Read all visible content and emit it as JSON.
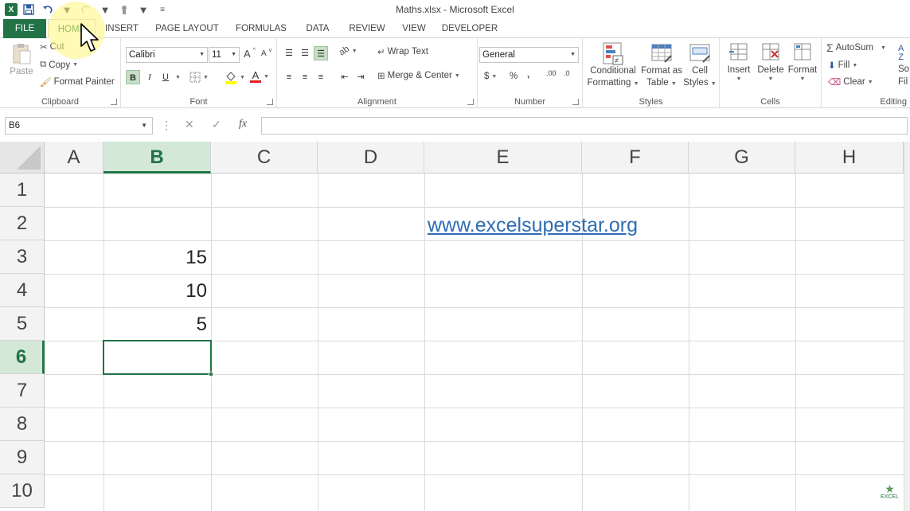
{
  "window": {
    "title": "Maths.xlsx - Microsoft Excel"
  },
  "tabs": [
    "FILE",
    "HOME",
    "INSERT",
    "PAGE LAYOUT",
    "FORMULAS",
    "DATA",
    "REVIEW",
    "VIEW",
    "DEVELOPER"
  ],
  "clipboard": {
    "paste": "Paste",
    "cut": "Cut",
    "copy": "Copy",
    "format_painter": "Format Painter",
    "label": "Clipboard"
  },
  "font": {
    "name": "Calibri",
    "size": "11",
    "grow": "A",
    "shrink": "A",
    "bold": "B",
    "italic": "I",
    "underline": "U",
    "font_color_letter": "A",
    "label": "Font"
  },
  "alignment": {
    "wrap_text": "Wrap Text",
    "merge_center": "Merge & Center",
    "label": "Alignment"
  },
  "number": {
    "format": "General",
    "currency": "$",
    "percent": "%",
    "comma": ",",
    "inc_decimal": ".00",
    "dec_decimal": ".0",
    "label": "Number"
  },
  "styles": {
    "conditional_1": "Conditional",
    "conditional_2": "Formatting",
    "format_table_1": "Format as",
    "format_table_2": "Table",
    "cell_styles_1": "Cell",
    "cell_styles_2": "Styles",
    "label": "Styles"
  },
  "cells": {
    "insert": "Insert",
    "delete": "Delete",
    "format": "Format",
    "label": "Cells"
  },
  "editing": {
    "autosum": "AutoSum",
    "fill": "Fill",
    "clear": "Clear",
    "label": "Editing",
    "sort_1": "So",
    "sort_2": "Fil"
  },
  "formula_bar": {
    "name_box": "B6",
    "fx": "fx",
    "value": ""
  },
  "grid": {
    "columns": [
      "A",
      "B",
      "C",
      "D",
      "E",
      "F",
      "G",
      "H"
    ],
    "rows": [
      "1",
      "2",
      "3",
      "4",
      "5",
      "6",
      "7",
      "8",
      "9",
      "10"
    ],
    "selected_column": "B",
    "selected_row": "6",
    "cells": {
      "B3": "15",
      "B4": "10",
      "B5": "5",
      "E2": "www.excelsuperstar.org"
    }
  },
  "watermark": "EXCEL"
}
